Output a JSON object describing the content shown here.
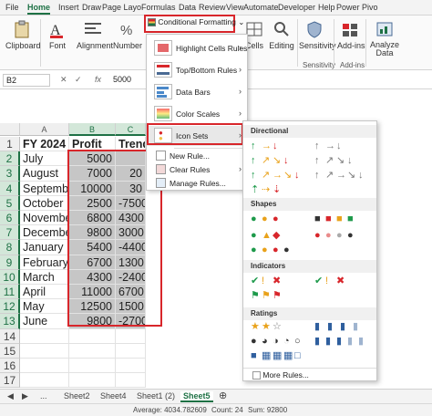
{
  "ribbon_tabs": [
    "File",
    "Home",
    "Insert",
    "Draw",
    "Page Layo",
    "Formulas",
    "Data",
    "Review",
    "View",
    "Automate",
    "Developer",
    "Help",
    "Power Pivo"
  ],
  "ribbon": {
    "clipboard": "Clipboard",
    "font": "Font",
    "alignment": "Alignment",
    "number": "Number",
    "cells": "Cells",
    "editing": "Editing",
    "sensitivity": "Sensitivity",
    "sensitivity_group": "Sensitivity",
    "addins": "Add-ins",
    "addins_group": "Add-ins",
    "analyze": "Analyze",
    "analyze2": "Data"
  },
  "formula_bar": {
    "name_box": "B2",
    "fx": "fx",
    "value": "5000"
  },
  "columns": [
    "A",
    "B",
    "C"
  ],
  "rows": [
    "1",
    "2",
    "3",
    "4",
    "5",
    "6",
    "7",
    "8",
    "9",
    "10",
    "11",
    "12",
    "13",
    "14",
    "15",
    "16",
    "17"
  ],
  "table": {
    "headers": [
      "FY 2024",
      "Profit",
      "Trend"
    ],
    "data": [
      [
        "July",
        "5000",
        ""
      ],
      [
        "August",
        "7000",
        "20"
      ],
      [
        "September",
        "10000",
        "30"
      ],
      [
        "October",
        "2500",
        "-7500"
      ],
      [
        "November",
        "6800",
        "4300"
      ],
      [
        "December",
        "9800",
        "3000"
      ],
      [
        "January",
        "5400",
        "-4400"
      ],
      [
        "February",
        "6700",
        "1300"
      ],
      [
        "March",
        "4300",
        "-2400"
      ],
      [
        "April",
        "11000",
        "6700"
      ],
      [
        "May",
        "12500",
        "1500"
      ],
      [
        "June",
        "9800",
        "-2700"
      ]
    ]
  },
  "cf_menu": {
    "button": "Conditional Formatting",
    "items": [
      "Highlight Cells Rules",
      "Top/Bottom Rules",
      "Data Bars",
      "Color Scales",
      "Icon Sets"
    ],
    "small_items": [
      "New Rule...",
      "Clear Rules",
      "Manage Rules..."
    ]
  },
  "icon_sets": {
    "sections": [
      "Directional",
      "Shapes",
      "Indicators",
      "Ratings"
    ],
    "more_rules": "More Rules..."
  },
  "sheets": [
    "Sheet2",
    "Sheet4",
    "Sheet1 (2)",
    "Sheet5"
  ],
  "status": {
    "average": "Average: 4034.782609",
    "count": "Count: 24",
    "sum": "Sum: 92800"
  },
  "colors": {
    "accent": "#1e7145",
    "highlight": "#d8262b",
    "selection": "#c6c6c6"
  }
}
